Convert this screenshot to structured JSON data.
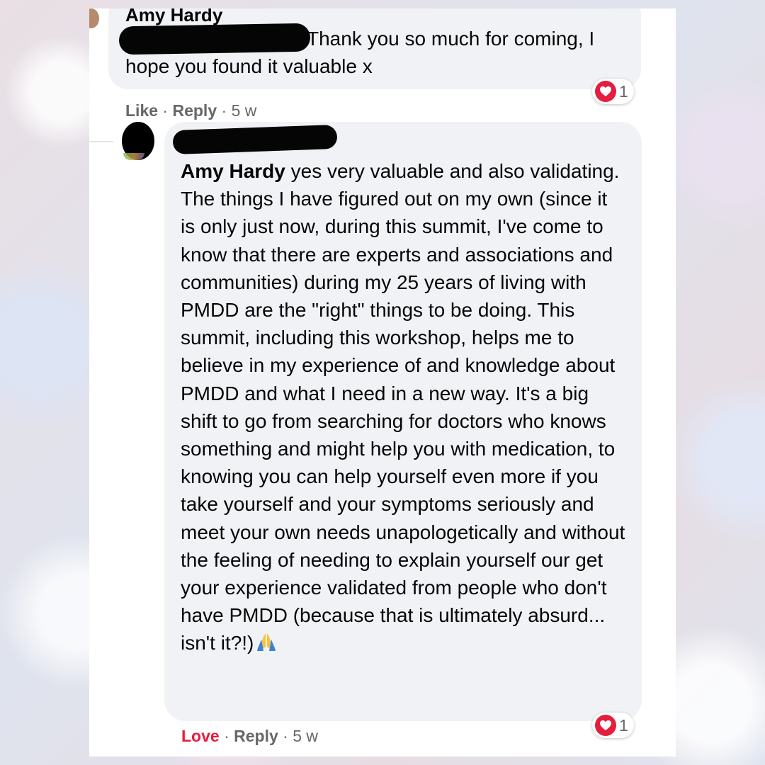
{
  "comment1": {
    "author": "Amy Hardy",
    "text": "Thank you so much for coming, I hope you found it valuable x",
    "actions": {
      "like": "Like",
      "reply": "Reply",
      "time": "5 w",
      "sep": "·"
    },
    "reaction_count": "1"
  },
  "comment2": {
    "mention": "Amy Hardy",
    "text": "yes very valuable and also validating. The things I have figured out on my own (since it is only just now, during this summit, I've come to know that there are experts and associations and communities) during my 25 years of living with PMDD are the \"right\" things to be doing. This summit, including this workshop, helps me to believe in my experience of and knowledge about PMDD and what I need in a new way. It's a big shift to go from searching for doctors who knows something and might help you with medication, to knowing you can help yourself even more if you take yourself and your symptoms seriously and meet your own needs unapologetically and without the feeling of needing to explain yourself our get your experience validated from people who don't have PMDD (because that is ultimately absurd... isn't it?!)",
    "emoji_icon": "folded-hands-icon",
    "actions": {
      "love": "Love",
      "reply": "Reply",
      "time": "5 w",
      "sep": "·"
    },
    "reaction_count": "1"
  },
  "colors": {
    "bubble": "#f0f2f5",
    "text": "#050505",
    "meta": "#65676b",
    "love": "#e41e3f",
    "heart": "#e41e3f"
  }
}
